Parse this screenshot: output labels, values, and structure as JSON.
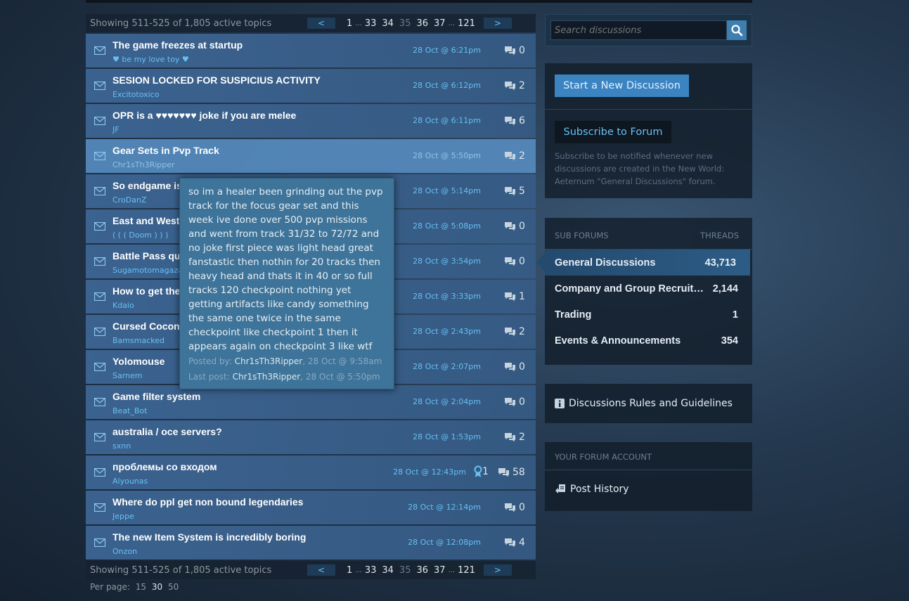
{
  "pagination": {
    "showing": "Showing 511-525 of 1,805 active topics",
    "prev": "<",
    "next": ">",
    "pages": [
      "1",
      "33",
      "34",
      "35",
      "36",
      "37",
      "121"
    ],
    "current_page": "35",
    "ellipsis": "..."
  },
  "topics": [
    {
      "title": "The game freezes at startup",
      "author": "♥ be my love toy ♥",
      "date": "28 Oct @ 6:21pm",
      "replies": "0"
    },
    {
      "title": "SESION LOCKED FOR SUSPICIUS ACTIVITY",
      "author": "Excitotoxico",
      "date": "28 Oct @ 6:12pm",
      "replies": "2"
    },
    {
      "title": "OPR is a ♥♥♥♥♥♥♥ joke if you are melee",
      "author": "JF",
      "date": "28 Oct @ 6:11pm",
      "replies": "6"
    },
    {
      "title": "Gear Sets in Pvp Track",
      "author": "Chr1sTh3Ripper",
      "date": "28 Oct @ 5:50pm",
      "replies": "2"
    },
    {
      "title": "So endgame is",
      "author": "CroDanZ",
      "date": "28 Oct @ 5:14pm",
      "replies": "5"
    },
    {
      "title": "East and West",
      "author": "( ( ( Doom ) ) )",
      "date": "28 Oct @ 5:08pm",
      "replies": "0"
    },
    {
      "title": "Battle Pass qu",
      "author": "Sugamotomagazai",
      "date": "28 Oct @ 3:54pm",
      "replies": "0"
    },
    {
      "title": "How to get the",
      "author": "Kdaio",
      "date": "28 Oct @ 3:33pm",
      "replies": "1"
    },
    {
      "title": "Cursed Cocon",
      "author": "Bamsmacked",
      "date": "28 Oct @ 2:43pm",
      "replies": "2"
    },
    {
      "title": "Yolomouse",
      "author": "Sarnem",
      "date": "28 Oct @ 2:07pm",
      "replies": "0"
    },
    {
      "title": "Game filter system",
      "author": "Beat_Bot",
      "date": "28 Oct @ 2:04pm",
      "replies": "0"
    },
    {
      "title": "australia / oce servers?",
      "author": "sxnn",
      "date": "28 Oct @ 1:53pm",
      "replies": "2"
    },
    {
      "title": "проблемы со входом",
      "author": "Alyounas",
      "date": "28 Oct @ 12:43pm",
      "replies": "58",
      "awards": "1"
    },
    {
      "title": "Where do ppl get non bound legendaries",
      "author": "Jeppe",
      "date": "28 Oct @ 12:14pm",
      "replies": "0"
    },
    {
      "title": "The new Item System is incredibly boring",
      "author": "Onzon",
      "date": "28 Oct @ 12:08pm",
      "replies": "4"
    }
  ],
  "per_page": {
    "label": "Per page:",
    "options": [
      "15",
      "30",
      "50"
    ],
    "selected": "30"
  },
  "tooltip": {
    "body": "so im a healer been grinding out the pvp track for the focus gear set and this week ive done over 500 pvp missions and went from track 31/32 to 72/72 and no joke first piece was light head great fanstastic then nothin for 20 tracks then heavy head and thats it in 40 or so full tracks 120 checkpoint nothing yet getting artifacts like candy something the same one twice in the same checkpoint like checkpoint 1 then it appears again on checkpoint 3 like wtf come on surely its bugged?...",
    "posted_label": "Posted by:",
    "posted_user": "Chr1sTh3Ripper",
    "posted_date": ", 28 Oct @ 9:58am",
    "last_label": "Last post:",
    "last_user": "Chr1sTh3Ripper",
    "last_date": ", 28 Oct @ 5:50pm"
  },
  "search": {
    "placeholder": "Search discussions"
  },
  "actions": {
    "new_discussion": "Start a New Discussion",
    "subscribe": "Subscribe to Forum",
    "subscribe_note": "Subscribe to be notified whenever new discussions are created in the New World: Aeternum \"General Discussions\" forum."
  },
  "subforums": {
    "header": "SUB FORUMS",
    "threads_header": "THREADS",
    "items": [
      {
        "name": "General Discussions",
        "threads": "43,713"
      },
      {
        "name": "Company and Group Recruitment",
        "threads": "2,144"
      },
      {
        "name": "Trading",
        "threads": "1"
      },
      {
        "name": "Events & Announcements",
        "threads": "354"
      }
    ]
  },
  "rules": {
    "label": "Discussions Rules and Guidelines"
  },
  "account": {
    "header": "YOUR FORUM ACCOUNT",
    "post_history": "Post History"
  },
  "colors": {
    "accent": "#66c0f4",
    "row": "#3e6796",
    "row_hover": "#5489ba",
    "button": "#3c84c1"
  }
}
